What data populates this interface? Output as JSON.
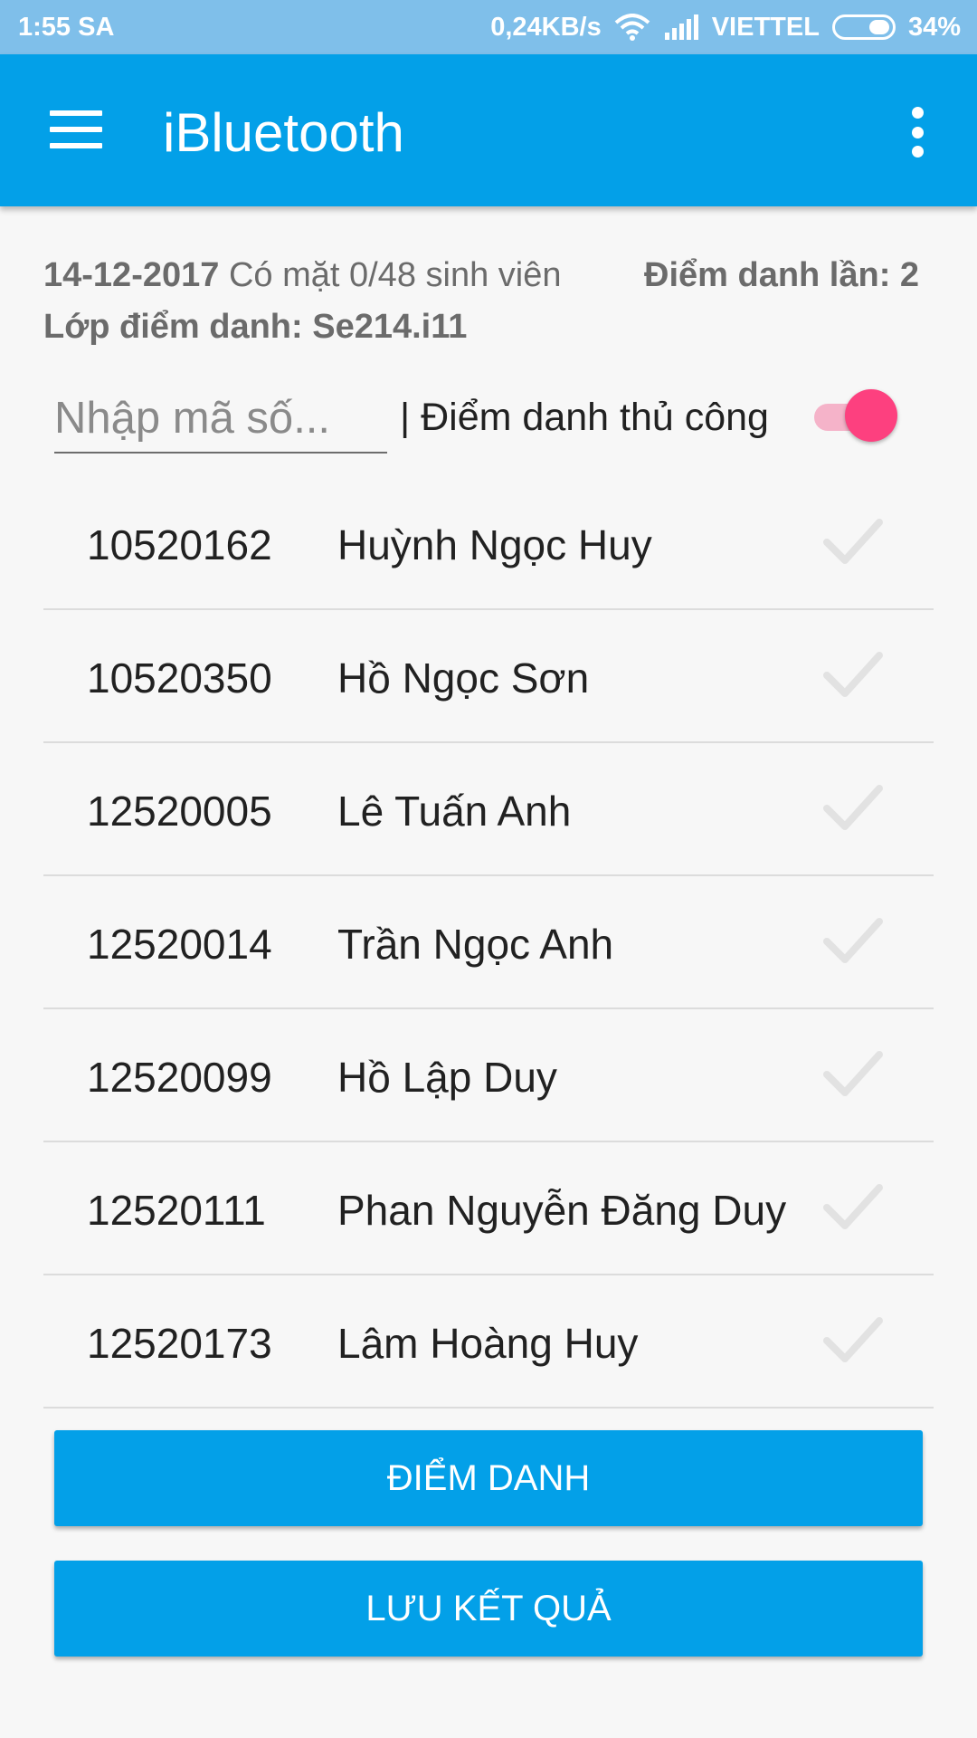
{
  "status_bar": {
    "time": "1:55 SA",
    "speed": "0,24KB/s",
    "carrier": "VIETTEL",
    "battery": "34%"
  },
  "app_bar": {
    "title": "iBluetooth",
    "menu_icon": "hamburger-menu-icon",
    "overflow_icon": "more-vert-icon",
    "color": "#03a0e8"
  },
  "info": {
    "date": "14-12-2017",
    "present_text": "Có mặt 0/48 sinh viên",
    "attempt_text": "Điểm danh lần: 2",
    "class_text": "Lớp điểm danh: Se214.i11"
  },
  "manual": {
    "input_placeholder": "Nhập mã số...",
    "label": "| Điểm danh thủ công",
    "toggle_on": true,
    "toggle_color": "#fd407f"
  },
  "students": [
    {
      "id": "10520162",
      "name": "Huỳnh Ngọc Huy"
    },
    {
      "id": "10520350",
      "name": "Hồ Ngọc Sơn"
    },
    {
      "id": "12520005",
      "name": "Lê Tuấn Anh"
    },
    {
      "id": "12520014",
      "name": "Trần Ngọc Anh"
    },
    {
      "id": "12520099",
      "name": "Hồ Lập Duy"
    },
    {
      "id": "12520111",
      "name": "Phan Nguyễn Đăng Duy"
    },
    {
      "id": "12520173",
      "name": "Lâm Hoàng Huy"
    }
  ],
  "buttons": {
    "attend_label": "ĐIỂM DANH",
    "save_label": "LƯU KẾT QUẢ"
  }
}
